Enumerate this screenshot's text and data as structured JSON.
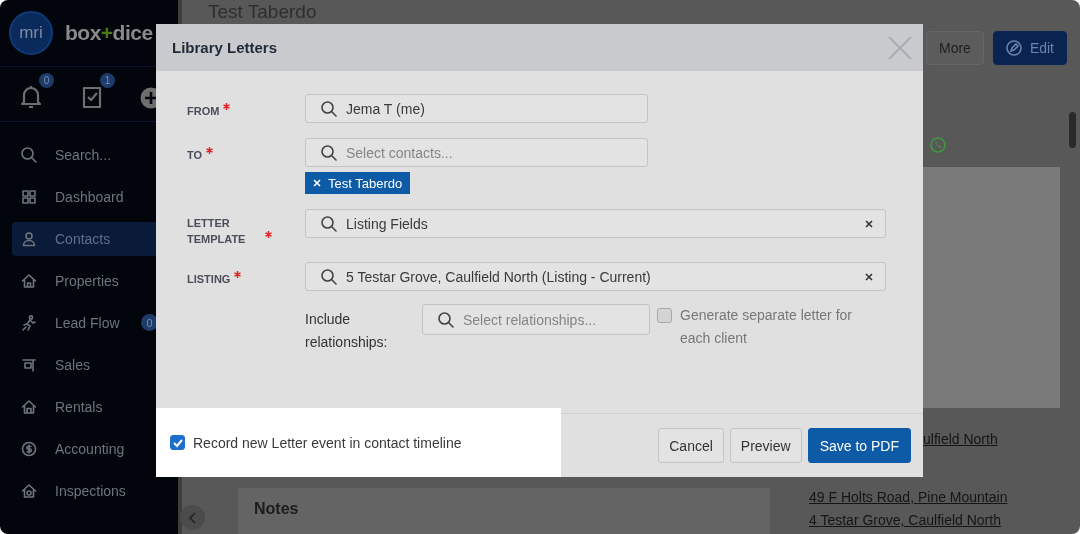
{
  "brand": {
    "mark": "mri",
    "name_left": "box",
    "name_plus": "+",
    "name_right": "dice"
  },
  "sidebar": {
    "quick_icons": [
      {
        "kind": "bell",
        "badge": "0"
      },
      {
        "kind": "tasks",
        "badge": "1"
      },
      {
        "kind": "add"
      }
    ],
    "search": {
      "placeholder": "Search..."
    },
    "items": [
      {
        "kind": "dashboard",
        "label": "Dashboard",
        "selected": false
      },
      {
        "kind": "contacts",
        "label": "Contacts",
        "selected": true
      },
      {
        "kind": "properties",
        "label": "Properties",
        "selected": false
      },
      {
        "kind": "leadflow",
        "label": "Lead Flow",
        "selected": false,
        "badge": "0"
      },
      {
        "kind": "sales",
        "label": "Sales",
        "selected": false
      },
      {
        "kind": "rentals",
        "label": "Rentals",
        "selected": false
      },
      {
        "kind": "accounting",
        "label": "Accounting",
        "selected": false
      },
      {
        "kind": "inspections",
        "label": "Inspections",
        "selected": false
      }
    ]
  },
  "page": {
    "title": "Test Taberdo",
    "buttons": [
      {
        "label": "More",
        "kind": "default"
      },
      {
        "label": "Edit",
        "kind": "primary"
      }
    ],
    "links": [
      {
        "label": "ulfield North",
        "cut": true
      },
      {
        "label": "49 F Holts Road, Pine Mountain",
        "cut": false
      },
      {
        "label": "4 Testar Grove, Caulfield North",
        "cut": false
      }
    ],
    "notes_title": "Notes"
  },
  "modal": {
    "title": "Library Letters",
    "fields": [
      {
        "label": "FROM",
        "required": true,
        "value": "Jema T (me)",
        "clearable": false
      },
      {
        "label": "TO",
        "required": true,
        "placeholder": "Select contacts...",
        "clearable": false,
        "chips": [
          "Test Taberdo"
        ]
      },
      {
        "label": "LETTER TEMPLATE",
        "required": true,
        "value": "Listing Fields",
        "clearable": true
      },
      {
        "label": "LISTING",
        "required": true,
        "value": "5 Testar Grove, Caulfield North (Listing - Current)",
        "clearable": true
      }
    ],
    "relationships": {
      "label": "Include relationships:",
      "placeholder": "Select relationships...",
      "separate_letter": {
        "label": "Generate separate letter for each client",
        "checked": false
      }
    },
    "record_event": {
      "label": "Record new Letter event in contact timeline",
      "checked": true,
      "highlighted": true
    },
    "buttons": [
      {
        "label": "Cancel",
        "kind": "default"
      },
      {
        "label": "Preview",
        "kind": "default"
      },
      {
        "label": "Save to PDF",
        "kind": "primary"
      }
    ]
  }
}
